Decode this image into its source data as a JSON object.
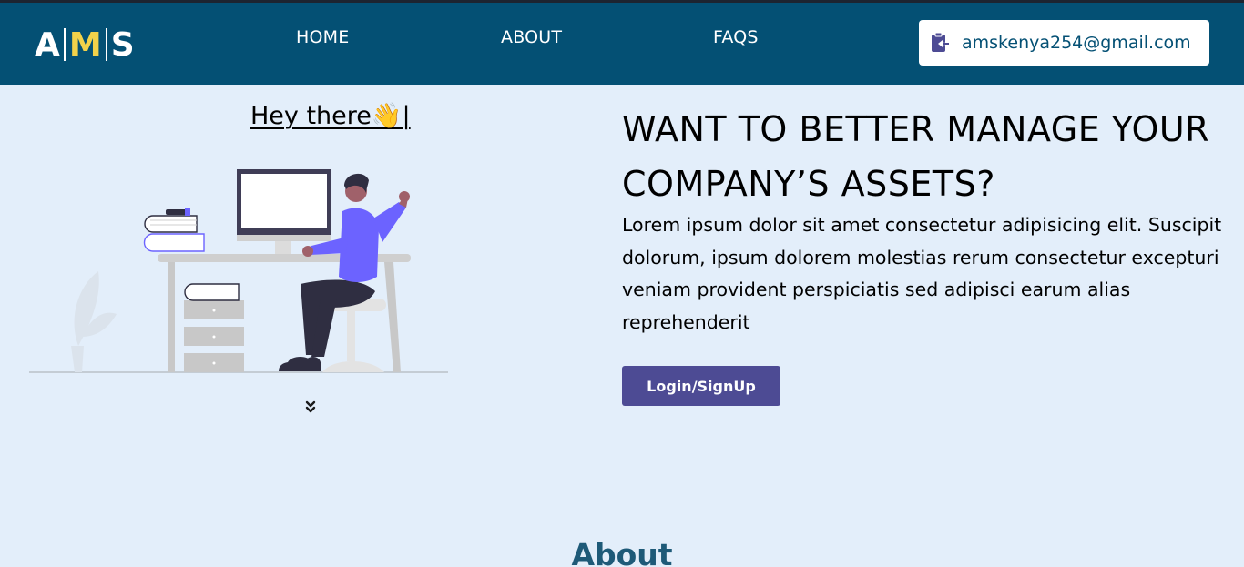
{
  "brand": {
    "logo_a": "A",
    "logo_m": "M",
    "logo_s": "S"
  },
  "nav": {
    "home": "HOME",
    "about": "ABOUT",
    "faqs": "FAQS"
  },
  "contact": {
    "email": "amskenya254@gmail.com",
    "icon": "clipboard-arrow-icon"
  },
  "hero": {
    "greeting": "Hey there👋|",
    "headline": "WANT TO BETTER MANAGE YOUR COMPANY’S ASSETS?",
    "description": "Lorem ipsum dolor sit amet consectetur adipisicing elit. Suscipit dolorum, ipsum dolorem molestias rerum consectetur excepturi veniam provident perspiciatis sed adipisci earum alias reprehenderit",
    "cta_label": "Login/SignUp",
    "scroll_icon": "double-chevron-down-icon"
  },
  "about": {
    "title": "About"
  },
  "colors": {
    "header_bg": "#045074",
    "page_bg": "#e3eefa",
    "logo_accent": "#f2d24a",
    "button_bg": "#4d4b94",
    "about_title": "#1e5a78"
  }
}
